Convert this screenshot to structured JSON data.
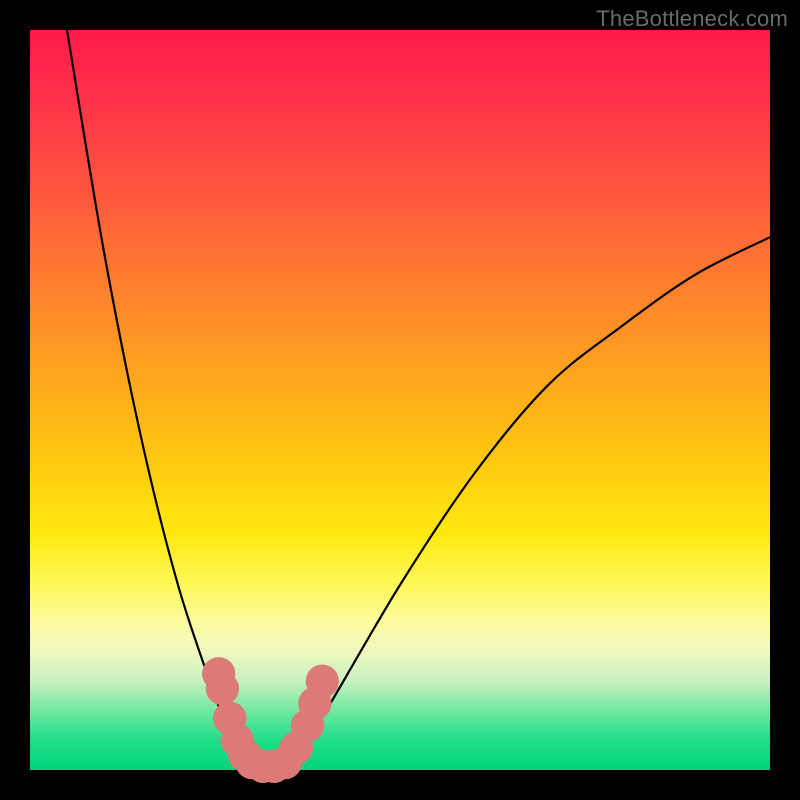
{
  "watermark": "TheBottleneck.com",
  "chart_data": {
    "type": "line",
    "title": "",
    "xlabel": "",
    "ylabel": "",
    "xlim": [
      0,
      100
    ],
    "ylim": [
      0,
      100
    ],
    "grid": false,
    "legend": false,
    "series": [
      {
        "name": "curve",
        "x": [
          5,
          10,
          15,
          20,
          25,
          27,
          30,
          33,
          36,
          40,
          50,
          60,
          70,
          80,
          90,
          100
        ],
        "y": [
          100,
          70,
          45,
          25,
          10,
          5,
          2,
          0,
          2,
          8,
          25,
          40,
          52,
          60,
          67,
          72
        ]
      }
    ],
    "markers": [
      {
        "x": 25.5,
        "y": 13,
        "r": 1.6
      },
      {
        "x": 26.0,
        "y": 11,
        "r": 1.6
      },
      {
        "x": 27.0,
        "y": 7,
        "r": 1.6
      },
      {
        "x": 28.0,
        "y": 4,
        "r": 1.6
      },
      {
        "x": 29.0,
        "y": 2,
        "r": 1.6
      },
      {
        "x": 30.0,
        "y": 1,
        "r": 1.6
      },
      {
        "x": 31.5,
        "y": 0.5,
        "r": 1.6
      },
      {
        "x": 33.0,
        "y": 0.5,
        "r": 1.6
      },
      {
        "x": 34.5,
        "y": 1,
        "r": 1.6
      },
      {
        "x": 36.0,
        "y": 3,
        "r": 1.6
      },
      {
        "x": 37.5,
        "y": 6,
        "r": 1.6
      },
      {
        "x": 38.5,
        "y": 9,
        "r": 1.6
      },
      {
        "x": 39.5,
        "y": 12,
        "r": 1.6
      }
    ],
    "background_gradient": {
      "top": "#ff1a4a",
      "bottom": "#00d47a"
    }
  }
}
